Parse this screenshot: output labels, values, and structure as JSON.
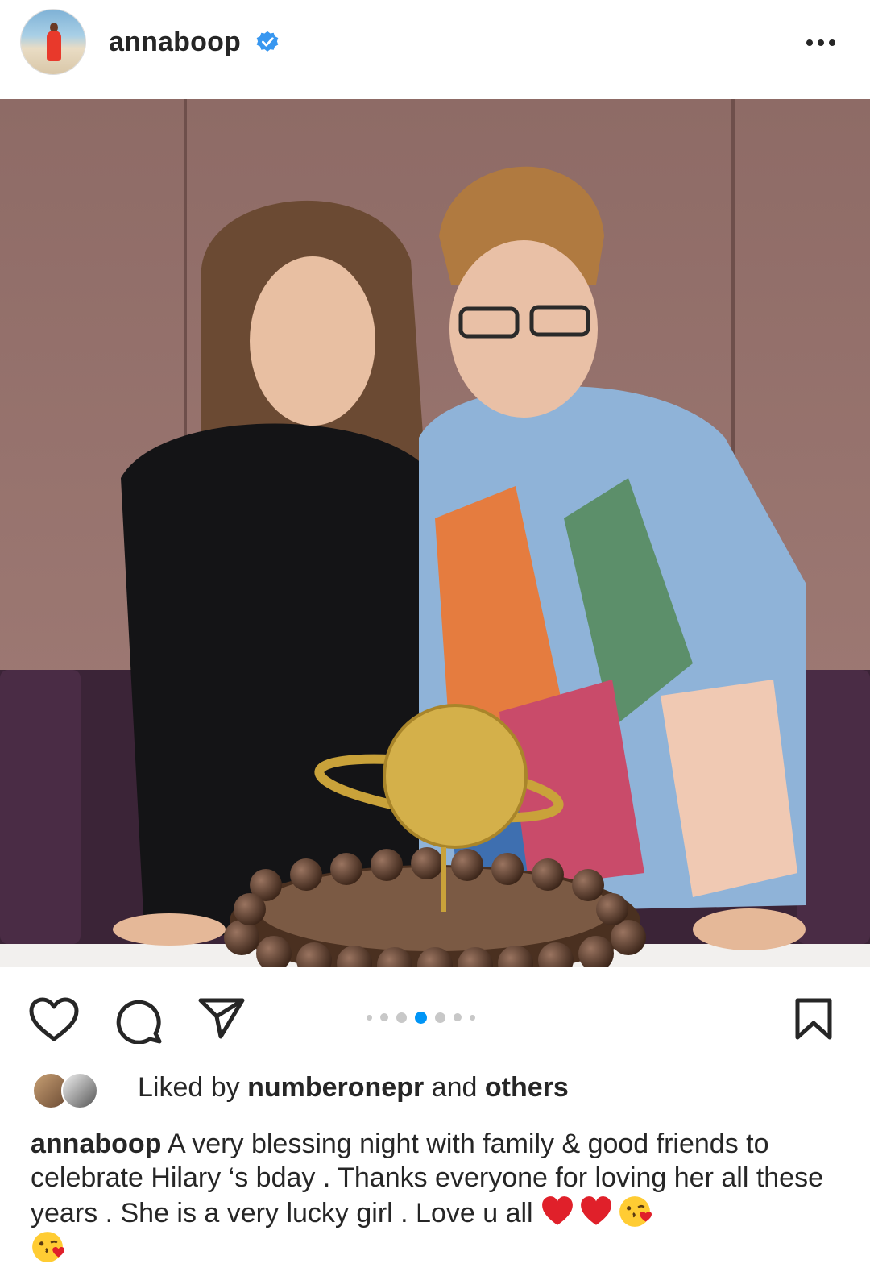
{
  "post": {
    "username": "annaboop",
    "verified": true
  },
  "carousel": {
    "total": 7,
    "active_index": 3
  },
  "likes": {
    "prefix": "Liked by",
    "user": "numberonepr",
    "connector": "and",
    "others": "others"
  },
  "caption": {
    "username": "annaboop",
    "text": "A very blessing night with family & good friends to celebrate Hilary ‘s bday . Thanks everyone for loving her all these years . She is a very lucky girl . Love u all"
  },
  "icons": {
    "like": "heart-icon",
    "comment": "comment-icon",
    "share": "share-icon",
    "save": "bookmark-icon",
    "more": "more-icon",
    "verified": "verified-badge-icon"
  },
  "colors": {
    "text": "#262626",
    "verified": "#3897f0",
    "active_dot": "#0095f6",
    "inactive_dot": "#c8c8c8"
  }
}
